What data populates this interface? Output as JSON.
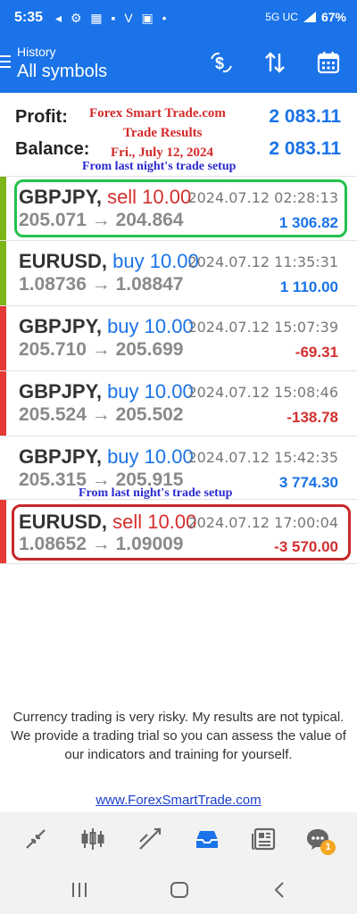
{
  "status_bar": {
    "time": "5:35",
    "icons_left": "◂ ⚙ ▦ ▪ V ▣ •",
    "network": "5G UC",
    "battery": "67%"
  },
  "app_bar": {
    "subtitle": "History",
    "title": "All symbols",
    "icons": [
      "currency-swap-icon",
      "sort-icon",
      "calendar-icon"
    ]
  },
  "summary": {
    "profit_label": "Profit:",
    "profit_value": "2 083.11",
    "balance_label": "Balance:",
    "balance_value": "2 083.11"
  },
  "overlay": {
    "line1": "Forex Smart Trade.com",
    "line2": "Trade Results",
    "line3": "Fri., July 12, 2024",
    "setup_note_1": "From last night's trade setup",
    "setup_note_2": "From last night's trade setup"
  },
  "trades": [
    {
      "symbol": "GBPJPY,",
      "side": "sell 10.00",
      "time": "2024.07.12 02:28:13",
      "prices": "205.071 → 204.864",
      "profit": "1 306.82"
    },
    {
      "symbol": "EURUSD,",
      "side": "buy 10.00",
      "time": "2024.07.12 11:35:31",
      "prices": "1.08736 → 1.08847",
      "profit": "1 110.00"
    },
    {
      "symbol": "GBPJPY,",
      "side": "buy 10.00",
      "time": "2024.07.12 15:07:39",
      "prices": "205.710 → 205.699",
      "profit": "-69.31"
    },
    {
      "symbol": "GBPJPY,",
      "side": "buy 10.00",
      "time": "2024.07.12 15:08:46",
      "prices": "205.524 → 205.502",
      "profit": "-138.78"
    },
    {
      "symbol": "GBPJPY,",
      "side": "buy 10.00",
      "time": "2024.07.12 15:42:35",
      "prices": "205.315 → 205.915",
      "profit": "3 774.30"
    },
    {
      "symbol": "EURUSD,",
      "side": "sell 10.00",
      "time": "2024.07.12 17:00:04",
      "prices": "1.08652 → 1.09009",
      "profit": "-3 570.00"
    }
  ],
  "disclaimer": {
    "text": "Currency trading is very risky. My results are not typical. We provide a trading trial so you can assess the value of our indicators and training for yourself.",
    "link": "www.ForexSmartTrade.com"
  },
  "bottom_nav": {
    "items": [
      "quotes-icon",
      "chart-icon",
      "trade-icon",
      "history-icon",
      "news-icon",
      "messages-icon"
    ],
    "active": "history-icon",
    "badge": "1"
  },
  "colors": {
    "primary": "#1a73e8",
    "sell": "#d32f2f",
    "loss_bar": "#e53935",
    "win_bar": "#7cb518",
    "highlight_win": "#22c24a",
    "highlight_loss": "#c62828"
  }
}
